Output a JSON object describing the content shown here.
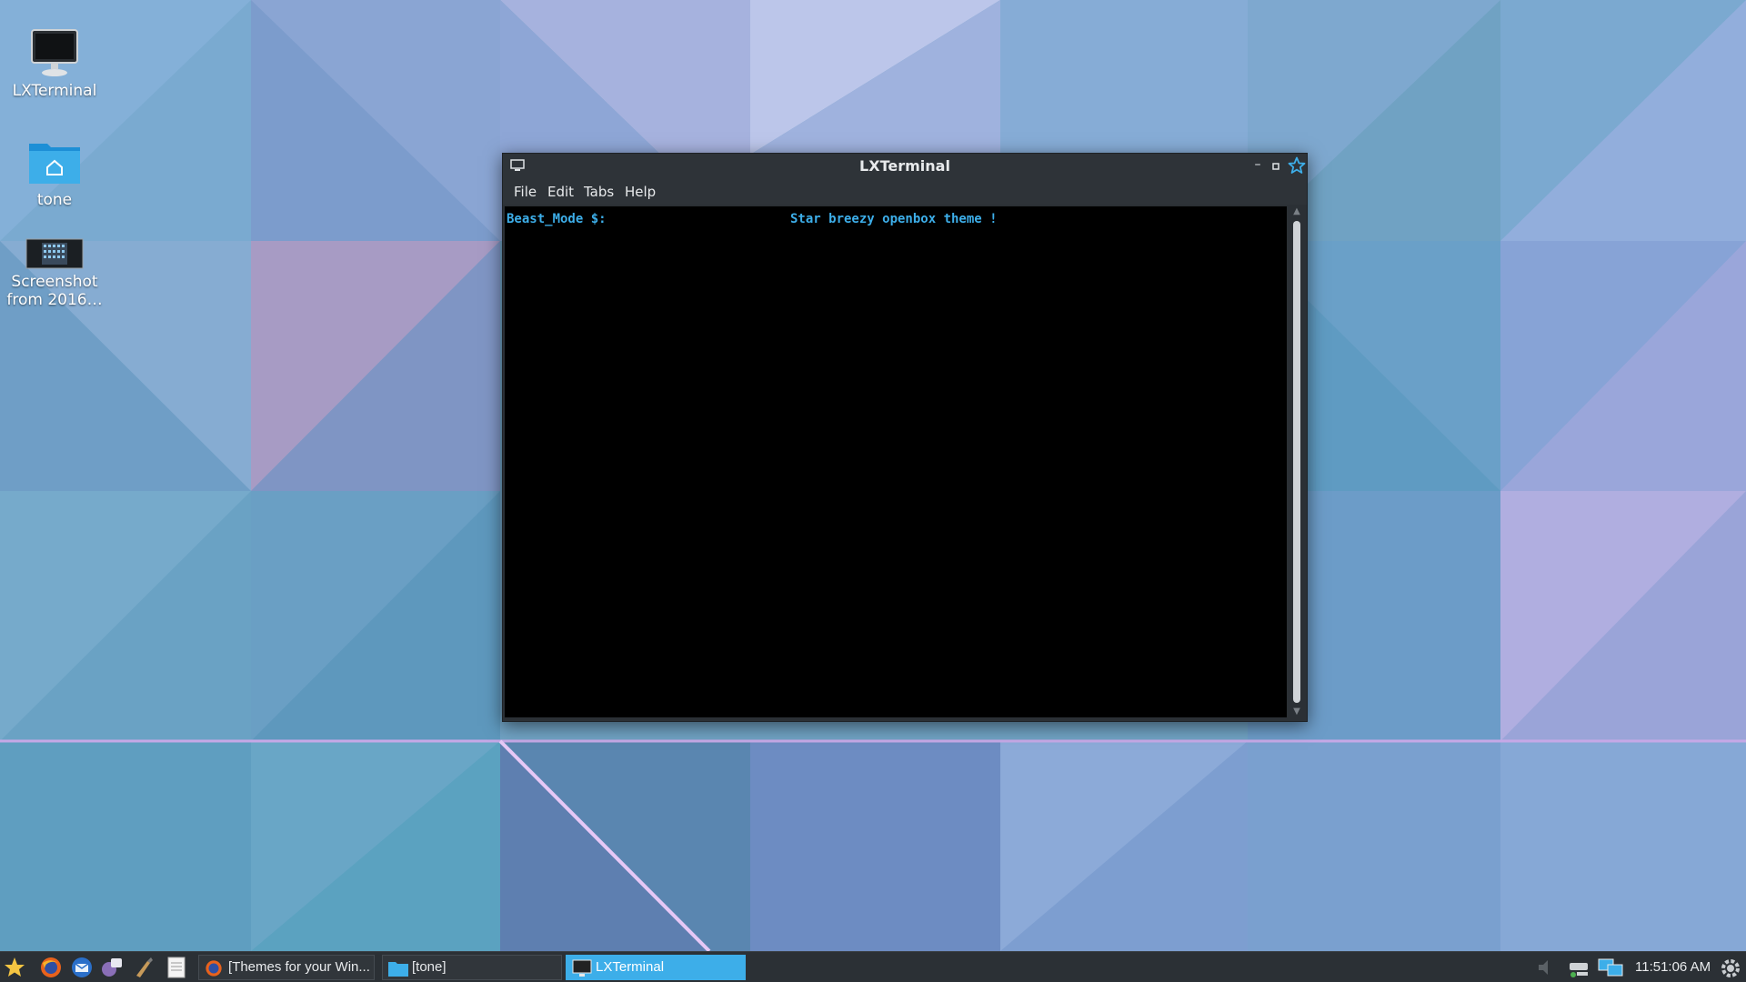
{
  "desktop": {
    "icons": [
      {
        "label": "LXTerminal",
        "icon": "terminal-icon"
      },
      {
        "label": "tone",
        "icon": "home-folder-icon"
      },
      {
        "label": "Screenshot from 2016…",
        "icon": "image-file-icon"
      }
    ]
  },
  "window": {
    "title": "LXTerminal",
    "menu": [
      "File",
      "Edit",
      "Tabs",
      "Help"
    ],
    "terminal": {
      "prompt": "Beast_Mode $:",
      "output": "Star breezy openbox theme !"
    },
    "buttons": {
      "minimize": "–"
    }
  },
  "taskbar": {
    "launchers": [
      "menu-star-icon",
      "firefox-icon",
      "thunderbird-icon",
      "messenger-icon",
      "brush-icon",
      "text-editor-icon"
    ],
    "tasks": [
      {
        "label": "[Themes for your Win...",
        "icon": "firefox-icon",
        "active": false
      },
      {
        "label": "[tone]",
        "icon": "folder-icon",
        "active": false
      },
      {
        "label": "LXTerminal",
        "icon": "terminal-icon",
        "active": true
      }
    ],
    "tray": [
      "volume-icon",
      "network-wired-icon",
      "network-display-icon"
    ],
    "clock": "11:51:06 AM"
  },
  "colors": {
    "accent": "#3daee9",
    "panel": "#2b3035",
    "terminal_bg": "#000000",
    "terminal_text": "#3daee9"
  }
}
